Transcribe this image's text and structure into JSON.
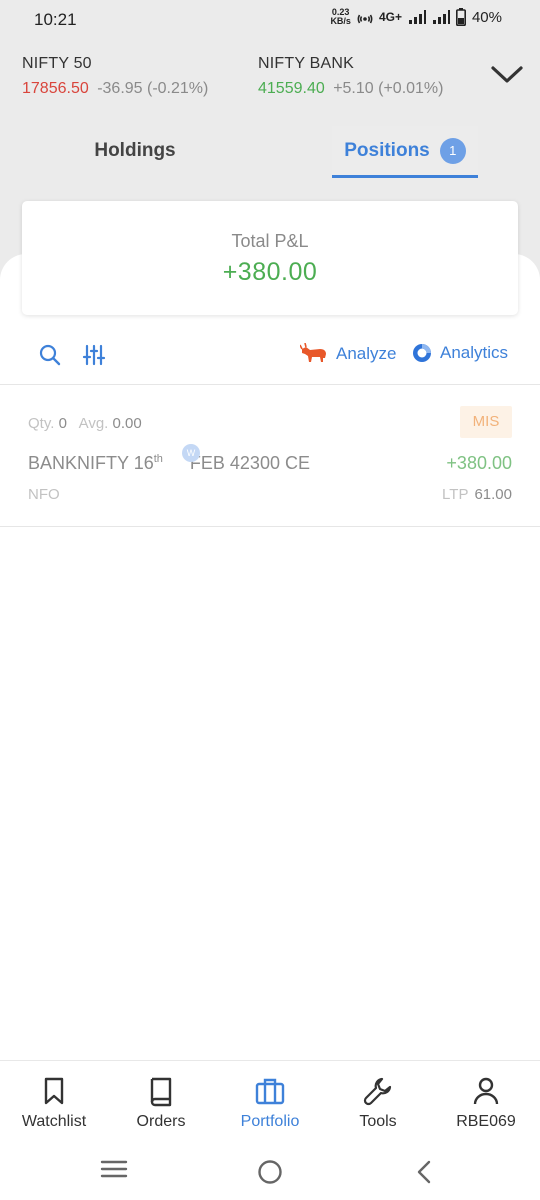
{
  "status_bar": {
    "time": "10:21",
    "net_speed": "0.23",
    "net_unit": "KB/s",
    "network": "4G+",
    "battery": "40%"
  },
  "indices": [
    {
      "name": "NIFTY 50",
      "value": "17856.50",
      "change": "-36.95 (-0.21%)",
      "color": "#d9453c"
    },
    {
      "name": "NIFTY BANK",
      "value": "41559.40",
      "change": "+5.10 (+0.01%)",
      "color": "#4cad52"
    }
  ],
  "tabs": {
    "holdings": "Holdings",
    "positions": "Positions",
    "positions_count": "1"
  },
  "summary": {
    "label": "Total P&L",
    "value": "+380.00"
  },
  "toolbar": {
    "analyze": "Analyze",
    "analytics": "Analytics"
  },
  "positions": [
    {
      "qty_label": "Qty.",
      "qty": "0",
      "avg_label": "Avg.",
      "avg": "0.00",
      "product": "MIS",
      "symbol_main": "BANKNIFTY 16",
      "symbol_sup": "th",
      "symbol_rest": " FEB 42300 CE",
      "expiry_badge": "W",
      "pnl": "+380.00",
      "exchange": "NFO",
      "ltp_label": "LTP",
      "ltp": "61.00"
    }
  ],
  "bottom_nav": {
    "watchlist": "Watchlist",
    "orders": "Orders",
    "portfolio": "Portfolio",
    "tools": "Tools",
    "profile": "RBE069",
    "active": "portfolio",
    "active_color": "#3e81d9"
  }
}
